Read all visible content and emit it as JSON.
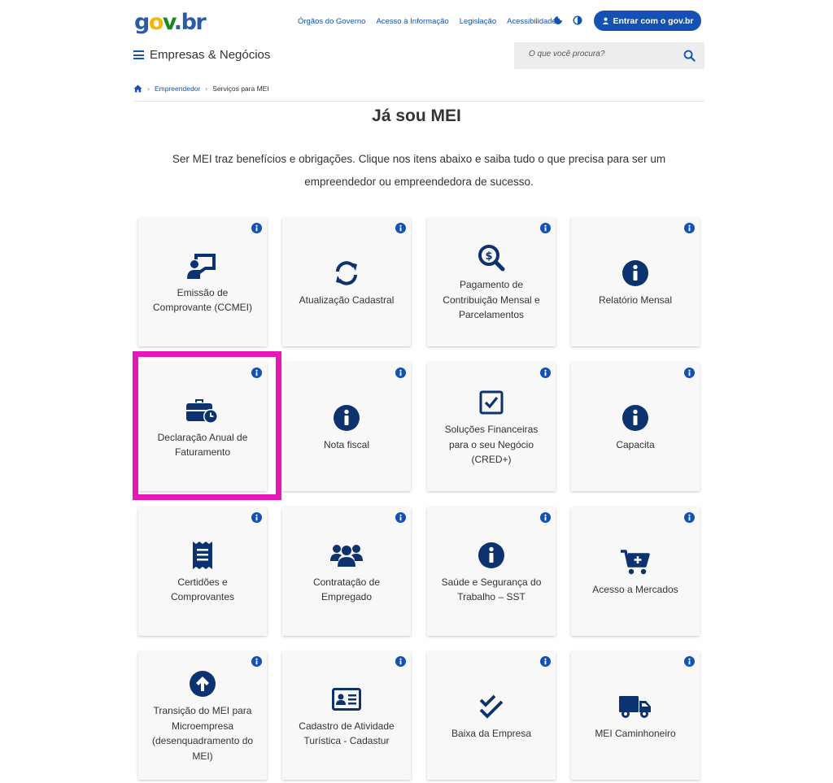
{
  "header": {
    "logo_parts": {
      "g": "g",
      "o": "o",
      "v": "v",
      "dot": ".",
      "br": "br"
    },
    "links": [
      "Órgãos do Governo",
      "Acesso à Informação",
      "Legislação",
      "Acessibilidade"
    ],
    "login_label": "Entrar com o gov.br",
    "section_title": "Empresas & Negócios",
    "search_placeholder": "O que você procura?"
  },
  "breadcrumb": {
    "item1": "Empreendedor",
    "item2": "Serviços para MEI"
  },
  "page": {
    "title": "Já sou MEI",
    "intro": "Ser MEI traz benefícios e obrigações. Clique nos itens abaixo e saiba tudo o que precisa para ser um empreendedor ou empreendedora de sucesso."
  },
  "cards": [
    {
      "label": "Emissão de Comprovante (CCMEI)",
      "icon": "presentation-user-icon"
    },
    {
      "label": "Atualização Cadastral",
      "icon": "sync-icon"
    },
    {
      "label": "Pagamento de Contribuição Mensal e Parcelamentos",
      "icon": "dollar-search-icon"
    },
    {
      "label": "Relatório Mensal",
      "icon": "info-circle-icon"
    },
    {
      "label": "Declaração Anual de Faturamento",
      "icon": "briefcase-clock-icon"
    },
    {
      "label": "Nota fiscal",
      "icon": "info-circle-icon"
    },
    {
      "label": "Soluções Financeiras para o seu Negócio (CRED+)",
      "icon": "checkbox-icon"
    },
    {
      "label": "Capacita",
      "icon": "info-circle-icon"
    },
    {
      "label": "Certidões e Comprovantes",
      "icon": "receipt-icon"
    },
    {
      "label": "Contratação de Empregado",
      "icon": "users-icon"
    },
    {
      "label": "Saúde e Segurança do Trabalho – SST",
      "icon": "info-circle-icon"
    },
    {
      "label": "Acesso a Mercados",
      "icon": "cart-plus-icon"
    },
    {
      "label": "Transição do MEI para Microempresa (desenquadramento do MEI)",
      "icon": "arrow-up-circle-icon"
    },
    {
      "label": "Cadastro de Atividade Turística - Cadastur",
      "icon": "id-card-icon"
    },
    {
      "label": "Baixa da Empresa",
      "icon": "double-check-icon"
    },
    {
      "label": "MEI Caminhoneiro",
      "icon": "truck-icon"
    }
  ],
  "colors": {
    "primary": "#1351b4",
    "icon": "#0c326f",
    "highlight": "#e619b8",
    "card_bg": "#f8f8f8"
  }
}
